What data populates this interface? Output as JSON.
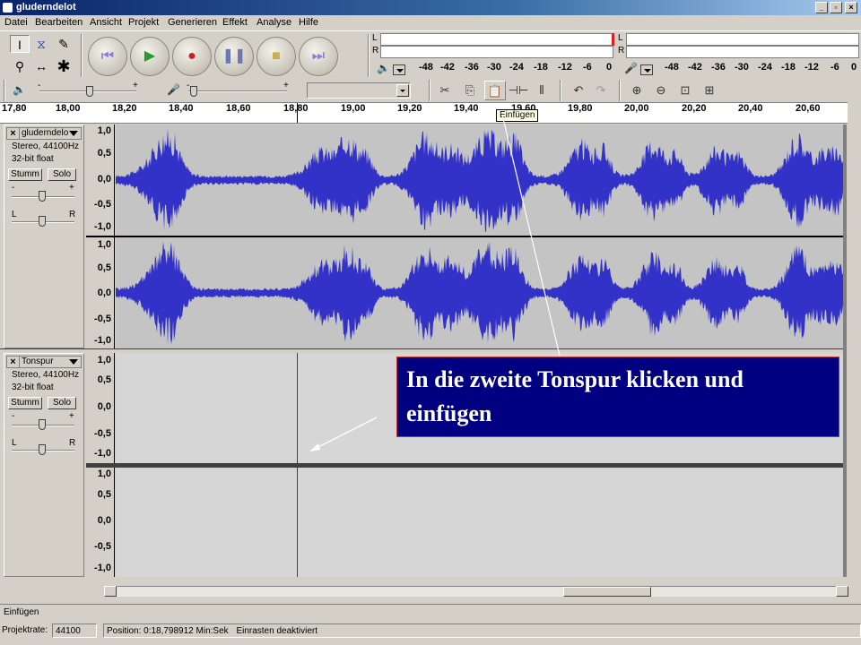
{
  "window": {
    "title": "gluderndelot"
  },
  "menu": [
    "Datei",
    "Bearbeiten",
    "Ansicht",
    "Projekt",
    "Generieren",
    "Effekt",
    "Analyse",
    "Hilfe"
  ],
  "meters": {
    "play_scale": [
      "-48",
      "-42",
      "-36",
      "-30",
      "-24",
      "-18",
      "-12",
      "-6",
      "0"
    ],
    "rec_scale": [
      "-48",
      "-42",
      "-36",
      "-30",
      "-24",
      "-18",
      "-12",
      "-6",
      "0"
    ],
    "left": "L",
    "right": "R"
  },
  "mixer": {
    "minus": "-",
    "plus": "+"
  },
  "ruler": {
    "ticks": [
      "17,80",
      "18,00",
      "18,20",
      "18,40",
      "18,60",
      "18,80",
      "19,00",
      "19,20",
      "19,40",
      "19,60",
      "19,80",
      "20,00",
      "20,20",
      "20,40",
      "20,60"
    ]
  },
  "tooltip": "Einfügen",
  "tracks": [
    {
      "name": "gluderndelo",
      "format": "Stereo, 44100Hz",
      "bits": "32-bit float",
      "mute": "Stumm",
      "solo": "Solo",
      "gain_minus": "-",
      "gain_plus": "+",
      "pan_left": "L",
      "pan_right": "R",
      "scale": [
        "1,0",
        "0,5",
        "0,0",
        "-0,5",
        "-1,0"
      ]
    },
    {
      "name": "Tonspur",
      "format": "Stereo, 44100Hz",
      "bits": "32-bit float",
      "mute": "Stumm",
      "solo": "Solo",
      "gain_minus": "-",
      "gain_plus": "+",
      "pan_left": "L",
      "pan_right": "R",
      "scale": [
        "1,0",
        "0,5",
        "0,0",
        "-0,5",
        "-1,0"
      ]
    }
  ],
  "callout": {
    "line1": "In die zweite Tonspur klicken und",
    "line2": "einfügen"
  },
  "status": {
    "message": "Einfügen",
    "rate_label": "Projektrate:",
    "rate_value": "44100",
    "position": "Position: 0:18,798912 Min:Sek",
    "snap": "Einrasten deaktiviert"
  },
  "colors": {
    "wave": "#3232c8",
    "wave_bg": "#c4c4c4",
    "callout_bg": "#000080",
    "titlebar": "#0a246a"
  }
}
